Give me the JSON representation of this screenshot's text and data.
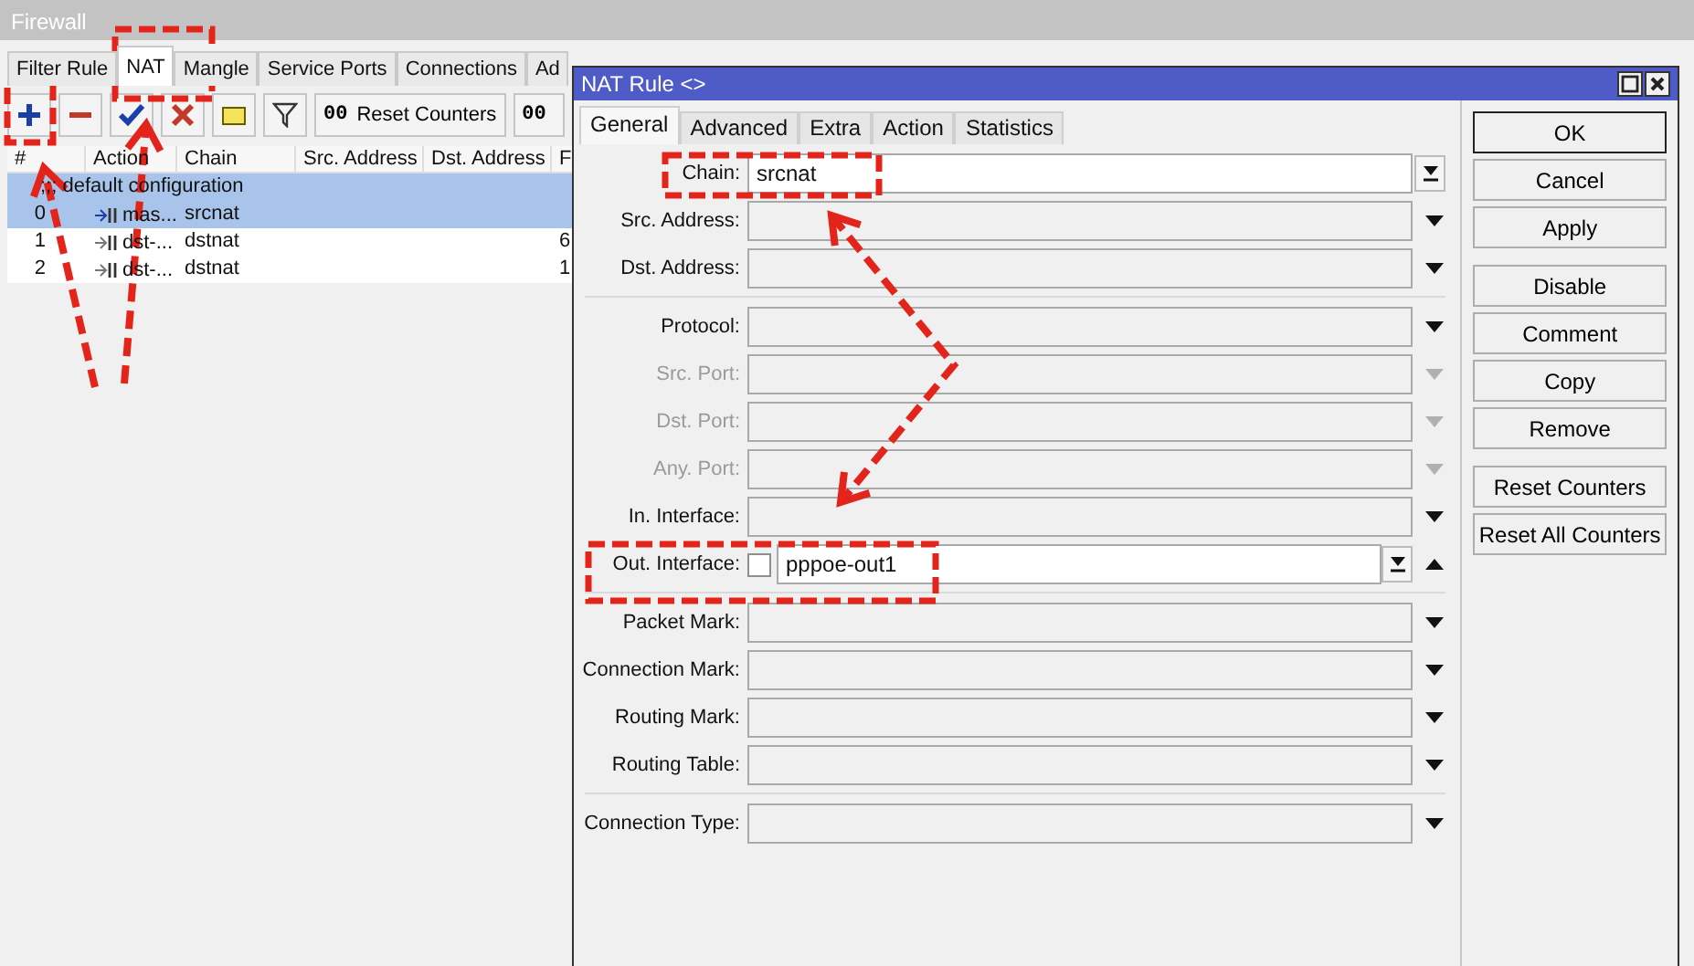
{
  "firewall_window": {
    "title": "Firewall",
    "tabs": [
      {
        "label": "Filter Rule",
        "selected": false
      },
      {
        "label": "NAT",
        "selected": true
      },
      {
        "label": "Mangle",
        "selected": false
      },
      {
        "label": "Service Ports",
        "selected": false
      },
      {
        "label": "Connections",
        "selected": false
      },
      {
        "label": "Ad",
        "selected": false
      }
    ],
    "toolbar": [
      {
        "kind": "add"
      },
      {
        "kind": "remove"
      },
      {
        "kind": "enable"
      },
      {
        "kind": "disable"
      },
      {
        "kind": "comment"
      },
      {
        "kind": "filter"
      },
      {
        "kind": "counter",
        "icon_text": "00",
        "label": "Reset Counters"
      },
      {
        "kind": "counter",
        "icon_text": "00"
      }
    ],
    "table": {
      "columns": [
        "#",
        "Action",
        "Chain",
        "Src. Address",
        "Dst. Address",
        "F"
      ],
      "rows": [
        {
          "kind": "comment",
          "text": ";;; default configuration",
          "selected": true
        },
        {
          "kind": "rule",
          "number": "0",
          "action": "mas...",
          "chain": "srcnat",
          "selected": true
        },
        {
          "kind": "rule",
          "number": "1",
          "action": "dst-...",
          "chain": "dstnat",
          "column_6": "6",
          "selected": false
        },
        {
          "kind": "rule",
          "number": "2",
          "action": "dst-...",
          "chain": "dstnat",
          "column_6": "1",
          "selected": false
        }
      ]
    }
  },
  "nat_rule_dialog": {
    "title": "NAT Rule <>",
    "tabs": [
      {
        "label": "General",
        "selected": true
      },
      {
        "label": "Advanced",
        "selected": false
      },
      {
        "label": "Extra",
        "selected": false
      },
      {
        "label": "Action",
        "selected": false
      },
      {
        "label": "Statistics",
        "selected": false
      }
    ],
    "sections": [
      {
        "fields": [
          {
            "kind": "combo",
            "label": "Chain:",
            "value": "srcnat",
            "disabled": false
          },
          {
            "kind": "dropdown",
            "label": "Src. Address:",
            "disabled": false
          },
          {
            "kind": "dropdown",
            "label": "Dst. Address:",
            "disabled": false
          }
        ]
      },
      {
        "fields": [
          {
            "kind": "dropdown",
            "label": "Protocol:",
            "disabled": false
          },
          {
            "kind": "dropdown",
            "label": "Src. Port:",
            "disabled": true
          },
          {
            "kind": "dropdown",
            "label": "Dst. Port:",
            "disabled": true
          },
          {
            "kind": "dropdown",
            "label": "Any. Port:",
            "disabled": true
          },
          {
            "kind": "dropdown",
            "label": "In. Interface:",
            "disabled": false
          },
          {
            "kind": "interface",
            "label": "Out. Interface:",
            "value": "pppoe-out1",
            "checked": false,
            "disabled": false
          }
        ]
      },
      {
        "fields": [
          {
            "kind": "dropdown",
            "label": "Packet Mark:",
            "disabled": false
          },
          {
            "kind": "dropdown",
            "label": "Connection Mark:",
            "disabled": false
          },
          {
            "kind": "dropdown",
            "label": "Routing Mark:",
            "disabled": false
          },
          {
            "kind": "dropdown",
            "label": "Routing Table:",
            "disabled": false
          }
        ]
      },
      {
        "fields": [
          {
            "kind": "dropdown",
            "label": "Connection Type:",
            "disabled": false
          }
        ]
      }
    ],
    "button_groups": [
      [
        {
          "label": "OK",
          "default": true
        },
        {
          "label": "Cancel",
          "default": false
        },
        {
          "label": "Apply",
          "default": false
        }
      ],
      [
        {
          "label": "Disable",
          "default": false
        },
        {
          "label": "Comment",
          "default": false
        },
        {
          "label": "Copy",
          "default": false
        },
        {
          "label": "Remove",
          "default": false
        }
      ],
      [
        {
          "label": "Reset Counters",
          "default": false
        },
        {
          "label": "Reset All Counters",
          "default": false
        }
      ]
    ]
  }
}
